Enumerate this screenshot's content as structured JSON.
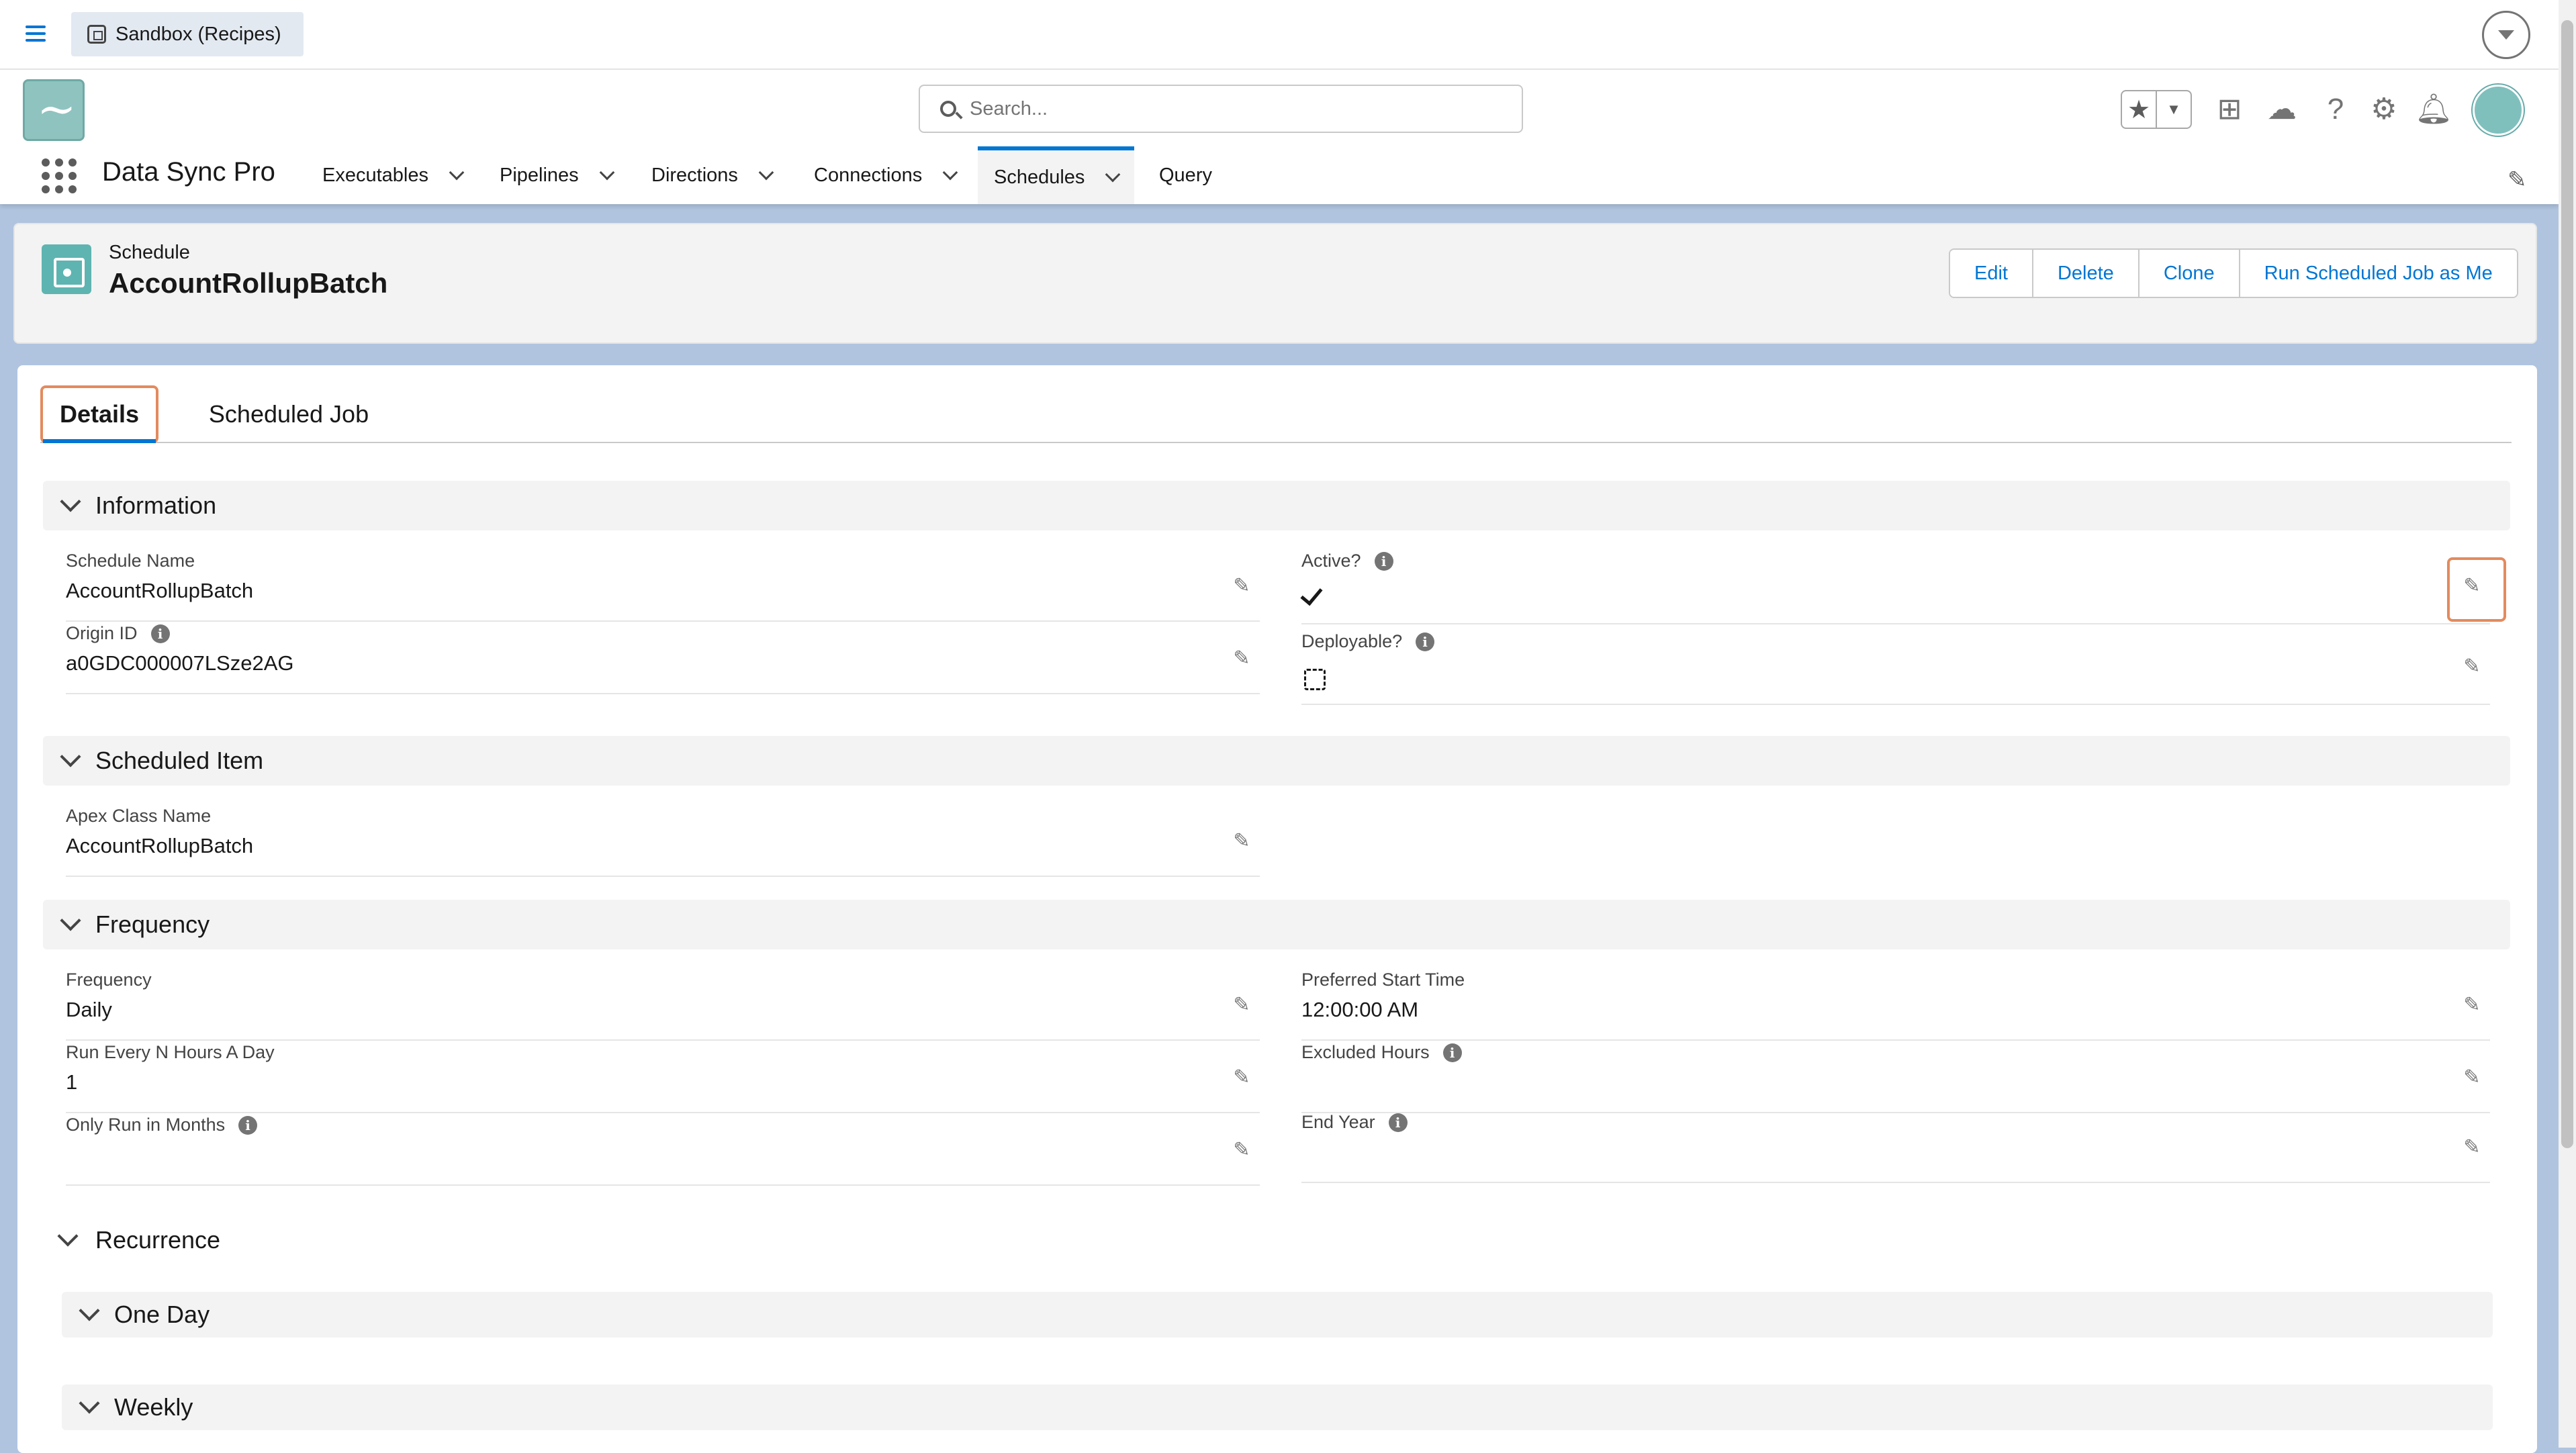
{
  "top": {
    "org_label": "Sandbox (Recipes)"
  },
  "header": {
    "search_placeholder": "Search...",
    "app_name": "Data Sync Pro",
    "nav": [
      {
        "label": "Executables",
        "has_menu": true
      },
      {
        "label": "Pipelines",
        "has_menu": true
      },
      {
        "label": "Directions",
        "has_menu": true
      },
      {
        "label": "Connections",
        "has_menu": true
      },
      {
        "label": "Schedules",
        "has_menu": true,
        "active": true
      },
      {
        "label": "Query",
        "has_menu": false
      }
    ]
  },
  "record": {
    "type": "Schedule",
    "name": "AccountRollupBatch",
    "actions": [
      "Edit",
      "Delete",
      "Clone",
      "Run Scheduled Job as Me"
    ]
  },
  "tabs": [
    "Details",
    "Scheduled Job"
  ],
  "sections": {
    "information": {
      "title": "Information",
      "schedule_name": {
        "label": "Schedule Name",
        "value": "AccountRollupBatch"
      },
      "origin_id": {
        "label": "Origin ID",
        "value": "a0GDC000007LSze2AG"
      },
      "active": {
        "label": "Active?",
        "checked": true
      },
      "deployable": {
        "label": "Deployable?",
        "checked": false
      }
    },
    "scheduled_item": {
      "title": "Scheduled Item",
      "apex_class": {
        "label": "Apex Class Name",
        "value": "AccountRollupBatch"
      }
    },
    "frequency": {
      "title": "Frequency",
      "frequency": {
        "label": "Frequency",
        "value": "Daily"
      },
      "preferred_start": {
        "label": "Preferred Start Time",
        "value": "12:00:00 AM"
      },
      "run_every": {
        "label": "Run Every N Hours A Day",
        "value": "1"
      },
      "excluded_hours": {
        "label": "Excluded Hours",
        "value": ""
      },
      "only_months": {
        "label": "Only Run in Months",
        "value": ""
      },
      "end_year": {
        "label": "End Year",
        "value": ""
      }
    },
    "recurrence": {
      "title": "Recurrence",
      "subsections": [
        "One Day",
        "Weekly"
      ]
    }
  },
  "icons": {
    "menu": "hamburger-icon",
    "search": "search-icon",
    "favorites": "star-icon",
    "add": "plus-icon",
    "trailhead": "cloud-icon",
    "help": "question-icon",
    "settings": "gear-icon",
    "notifications": "bell-icon",
    "edit": "pencil-icon"
  },
  "colors": {
    "brand": "#0176d3",
    "focus": "#e38b5e",
    "page_bg": "#b0c4df"
  }
}
